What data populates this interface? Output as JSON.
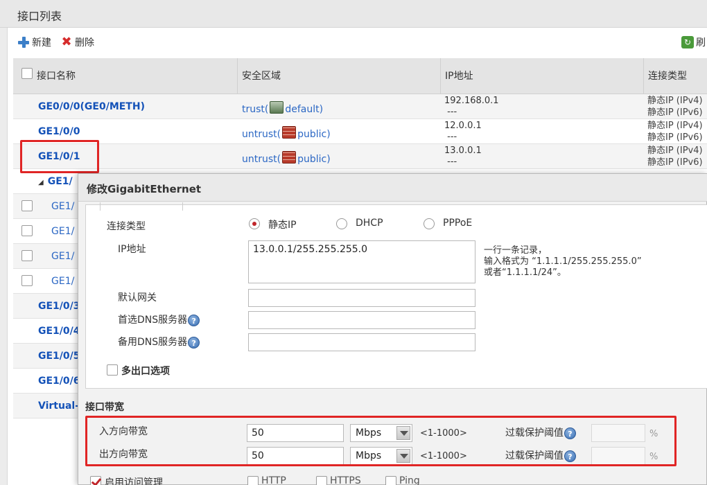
{
  "panel": {
    "title": "接口列表"
  },
  "toolbar": {
    "new_label": "新建",
    "delete_label": "删除",
    "refresh_label": "刷"
  },
  "table": {
    "headers": {
      "name": "接口名称",
      "zone": "安全区域",
      "ip": "IP地址",
      "type": "连接类型"
    },
    "rows": [
      {
        "name": "GE0/0/0(GE0/METH)",
        "zone_prefix": "trust(",
        "zone_suffix": "default)",
        "zone_icon": "trust-zone-icon",
        "ip": "192.168.0.1\n ---",
        "type": "静态IP (IPv4)\n静态IP (IPv6)"
      },
      {
        "name": "GE1/0/0",
        "zone_prefix": "untrust(",
        "zone_suffix": "public)",
        "zone_icon": "untrust-zone-icon",
        "ip": "12.0.0.1\n ---",
        "type": "静态IP (IPv4)\n静态IP (IPv6)"
      },
      {
        "name": "GE1/0/1",
        "zone_prefix": "untrust(",
        "zone_suffix": "public)",
        "zone_icon": "untrust-zone-icon",
        "ip": "13.0.0.1\n ---",
        "type": "静态IP (IPv4)\n静态IP (IPv6)"
      },
      {
        "name": "GE1/"
      },
      {
        "name": "GE1/"
      },
      {
        "name": "GE1/"
      },
      {
        "name": "GE1/"
      },
      {
        "name": "GE1/"
      },
      {
        "name": "GE1/0/3"
      },
      {
        "name": "GE1/0/4"
      },
      {
        "name": "GE1/0/5"
      },
      {
        "name": "GE1/0/6"
      },
      {
        "name": "Virtual-"
      }
    ]
  },
  "dialog": {
    "title": "修改GigabitEthernet",
    "conn_type_label": "连接类型",
    "conn_options": [
      "静态IP",
      "DHCP",
      "PPPoE"
    ],
    "ip_label": "IP地址",
    "ip_value": "13.0.0.1/255.255.255.0",
    "ip_hint": [
      "一行一条记录，",
      "输入格式为 “1.1.1.1/255.255.255.0”",
      "或者“1.1.1.1/24”。"
    ],
    "gateway_label": "默认网关",
    "dns1_label": "首选DNS服务器",
    "dns2_label": "备用DNS服务器",
    "multi_exit_label": "多出口选项",
    "bandwidth_section": "接口带宽",
    "in_bw_label": "入方向带宽",
    "in_bw_value": "50",
    "out_bw_label": "出方向带宽",
    "out_bw_value": "50",
    "unit": "Mbps",
    "range": "<1-1000>",
    "overload_label": "过载保护阈值",
    "percent": "%",
    "access_mgmt_label": "启用访问管理",
    "access_options": [
      "HTTP",
      "HTTPS",
      "Ping"
    ],
    "help_glyph": "?"
  },
  "colors": {
    "highlight": "#e02525",
    "link": "#1452b8",
    "radio_on": "#c0262b"
  }
}
